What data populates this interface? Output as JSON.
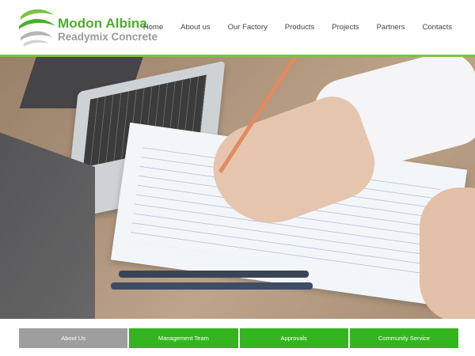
{
  "brand": {
    "name": "Modon Albina",
    "tagline": "Readymix Concrete",
    "logo_icon": "swoosh-logo-icon",
    "primary_color": "#4dad2e",
    "secondary_color": "#9a9a9a"
  },
  "nav": {
    "items": [
      {
        "label": "Home"
      },
      {
        "label": "About us"
      },
      {
        "label": "Our Factory"
      },
      {
        "label": "Products"
      },
      {
        "label": "Projects"
      },
      {
        "label": "Partners"
      },
      {
        "label": "Contacts"
      }
    ]
  },
  "hero": {
    "image_subject": "office-desk-plans-photo"
  },
  "tabs": {
    "items": [
      {
        "label": "About Us",
        "active": true
      },
      {
        "label": "Management Team",
        "active": false
      },
      {
        "label": "Approvals",
        "active": false
      },
      {
        "label": "Community Service",
        "active": false
      }
    ],
    "active_color": "#9e9e9e",
    "inactive_color": "#34b51f"
  }
}
